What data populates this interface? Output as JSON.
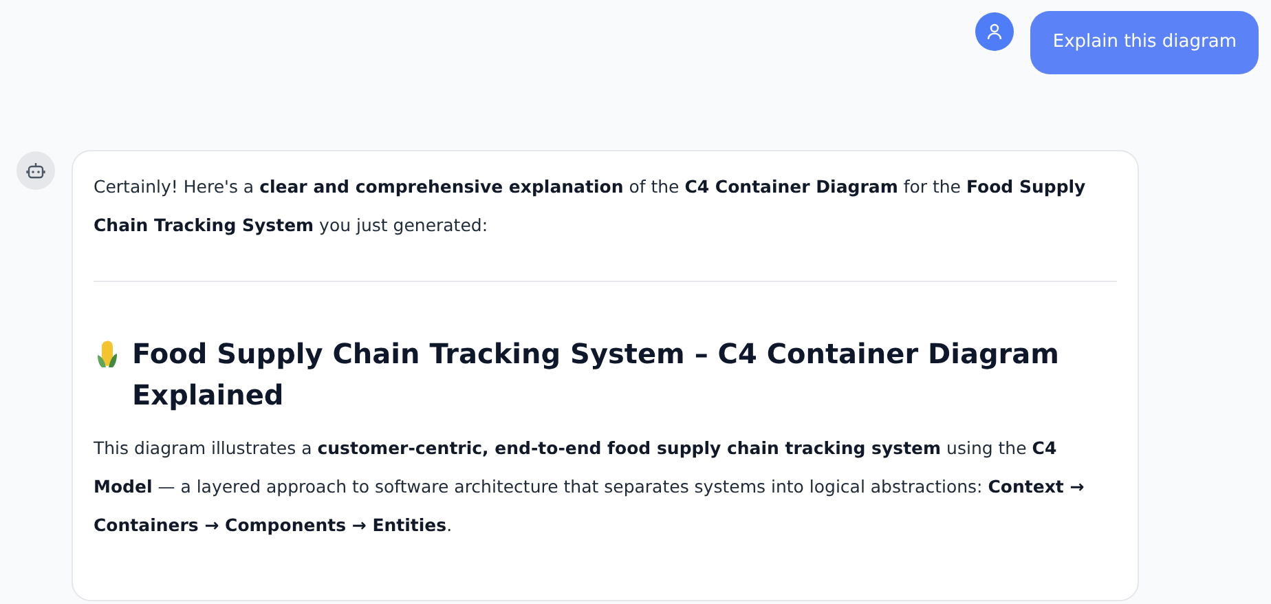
{
  "user_message": {
    "text": "Explain this diagram"
  },
  "assistant_message": {
    "intro": "Certainly! Here's a **clear and comprehensive explanation** of the **C4 Container Diagram** for the **Food Supply Chain Tracking System** you just generated:",
    "heading": "Food Supply Chain Tracking System – C4 Container Diagram Explained",
    "paragraph": "This diagram illustrates a **customer-centric, end-to-end food supply chain tracking system** using the **C4 Model** — a layered approach to software architecture that separates systems into logical abstractions: **Context → Containers → Components → Entities**."
  }
}
